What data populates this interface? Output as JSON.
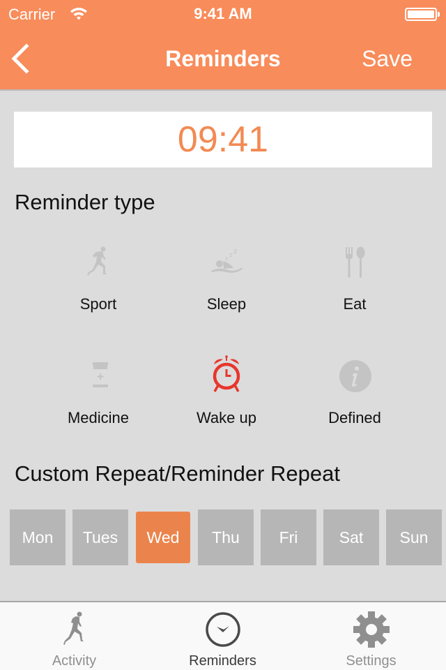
{
  "status_bar": {
    "carrier": "Carrier",
    "time": "9:41 AM",
    "battery_level": 1.0
  },
  "nav": {
    "back_icon": "chevron-left-icon",
    "title": "Reminders",
    "save_label": "Save"
  },
  "time_display": "09:41",
  "reminder_type": {
    "title": "Reminder type",
    "selected": "Wake up",
    "items": [
      {
        "label": "Sport",
        "icon": "running-icon",
        "selected": false
      },
      {
        "label": "Sleep",
        "icon": "sleep-icon",
        "selected": false
      },
      {
        "label": "Eat",
        "icon": "fork-spoon-icon",
        "selected": false
      },
      {
        "label": "Medicine",
        "icon": "medicine-bottle-icon",
        "selected": false
      },
      {
        "label": "Wake up",
        "icon": "alarm-clock-icon",
        "selected": true
      },
      {
        "label": "Defined",
        "icon": "info-icon",
        "selected": false
      }
    ]
  },
  "repeat": {
    "title": "Custom Repeat/Reminder Repeat",
    "days": [
      {
        "label": "Mon",
        "selected": false
      },
      {
        "label": "Tues",
        "selected": false
      },
      {
        "label": "Wed",
        "selected": true
      },
      {
        "label": "Thu",
        "selected": false
      },
      {
        "label": "Fri",
        "selected": false
      },
      {
        "label": "Sat",
        "selected": false
      },
      {
        "label": "Sun",
        "selected": false
      }
    ]
  },
  "tab_bar": {
    "active": "Reminders",
    "tabs": [
      {
        "label": "Activity",
        "icon": "running-icon"
      },
      {
        "label": "Reminders",
        "icon": "clock-icon"
      },
      {
        "label": "Settings",
        "icon": "gear-icon"
      }
    ]
  },
  "colors": {
    "header": "#f88c5a",
    "accent": "#eb844c",
    "time_text": "#f28a53",
    "alarm_selected": "#e8362c",
    "icon_inactive": "#c4c4c4",
    "day_inactive": "#b6b6b6",
    "background": "#dcdcdc"
  }
}
